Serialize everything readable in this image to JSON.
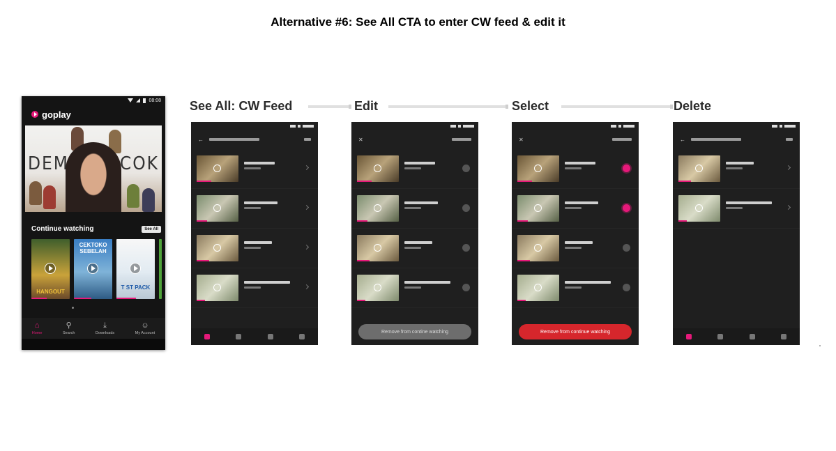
{
  "page": {
    "title": "Alternative #6: See All CTA to enter CW feed & edit it"
  },
  "home": {
    "status_time": "08:08",
    "brand": "goplay",
    "hero": {
      "title_left": "DEMI",
      "title_right": "UCOK"
    },
    "section_title": "Continue watching",
    "see_all": "See All",
    "posters": [
      {
        "title": "HANGOUT",
        "progress": 0.4
      },
      {
        "title": "CEKTOKO SEBELAH",
        "progress": 0.45
      },
      {
        "title": "T ST PACK",
        "progress": 0.5
      }
    ],
    "nav": [
      {
        "label": "Home",
        "icon": "home-icon"
      },
      {
        "label": "Search",
        "icon": "search-icon"
      },
      {
        "label": "Downloads",
        "icon": "download-icon"
      },
      {
        "label": "My Account",
        "icon": "account-icon"
      }
    ]
  },
  "steps": [
    {
      "label": "See All: CW Feed"
    },
    {
      "label": "Edit"
    },
    {
      "label": "Select"
    },
    {
      "label": "Delete"
    }
  ],
  "screens": {
    "edit": {
      "button": "Remove from contine watching"
    },
    "select": {
      "button": "Remove from continue watching"
    }
  },
  "colors": {
    "accent": "#e6197a",
    "remove_active": "#d6262c",
    "remove_disabled": "#6d6d6d"
  }
}
